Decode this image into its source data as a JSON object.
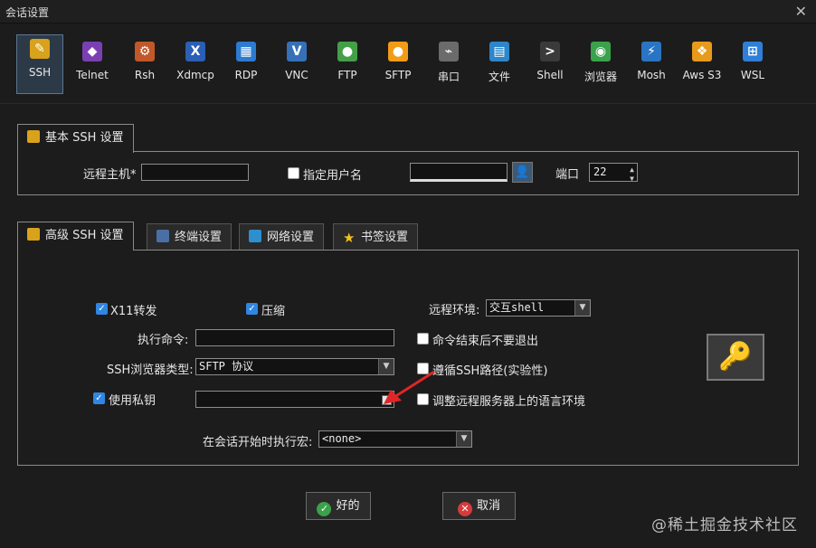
{
  "window": {
    "title": "会话设置"
  },
  "protocols": [
    {
      "label": "SSH",
      "icon": "wrench-icon",
      "color": "#d9a21b",
      "glyph": "✎",
      "active": true
    },
    {
      "label": "Telnet",
      "icon": "telnet-icon",
      "color": "#7b3fb4",
      "glyph": "◆"
    },
    {
      "label": "Rsh",
      "icon": "rsh-icon",
      "color": "#c0582a",
      "glyph": "⚙"
    },
    {
      "label": "Xdmcp",
      "icon": "xdmcp-icon",
      "color": "#2a5fb6",
      "glyph": "X"
    },
    {
      "label": "RDP",
      "icon": "rdp-icon",
      "color": "#2c7bd0",
      "glyph": "▦"
    },
    {
      "label": "VNC",
      "icon": "vnc-icon",
      "color": "#3670b8",
      "glyph": "V"
    },
    {
      "label": "FTP",
      "icon": "ftp-icon",
      "color": "#43a047",
      "glyph": "●"
    },
    {
      "label": "SFTP",
      "icon": "sftp-icon",
      "color": "#f29b17",
      "glyph": "●"
    },
    {
      "label": "串口",
      "icon": "serial-icon",
      "color": "#6b6b6b",
      "glyph": "⌁"
    },
    {
      "label": "文件",
      "icon": "file-icon",
      "color": "#2d86c9",
      "glyph": "▤"
    },
    {
      "label": "Shell",
      "icon": "shell-icon",
      "color": "#3a3a3a",
      "glyph": ">"
    },
    {
      "label": "浏览器",
      "icon": "browser-icon",
      "color": "#3aa24a",
      "glyph": "◉"
    },
    {
      "label": "Mosh",
      "icon": "mosh-icon",
      "color": "#2a74c4",
      "glyph": "⚡"
    },
    {
      "label": "Aws S3",
      "icon": "aws-s3-icon",
      "color": "#e89a1a",
      "glyph": "❖"
    },
    {
      "label": "WSL",
      "icon": "wsl-icon",
      "color": "#2f7fd8",
      "glyph": "⊞"
    }
  ],
  "basic": {
    "tab_label": "基本 SSH 设置",
    "remote_host_label": "远程主机*",
    "remote_host_value": "",
    "specify_user_label": "指定用户名",
    "username_value": "",
    "port_label": "端口",
    "port_value": "22"
  },
  "advanced": {
    "tabs": [
      "高级 SSH 设置",
      "终端设置",
      "网络设置",
      "书签设置"
    ],
    "x11_label": "X11转发",
    "compression_label": "压缩",
    "remote_env_label": "远程环境:",
    "remote_env_value": "交互shell",
    "exec_cmd_label": "执行命令:",
    "exec_cmd_value": "",
    "no_exit_label": "命令结束后不要退出",
    "browser_type_label": "SSH浏览器类型:",
    "browser_type_value": "SFTP 协议",
    "follow_path_label": "遵循SSH路径(实验性)",
    "private_key_label": "使用私钥",
    "private_key_value": "",
    "adjust_locale_label": "调整远程服务器上的语言环境",
    "macro_label": "在会话开始时执行宏:",
    "macro_value": "<none>"
  },
  "buttons": {
    "ok": "好的",
    "cancel": "取消"
  },
  "watermark": "@稀土掘金技术社区"
}
